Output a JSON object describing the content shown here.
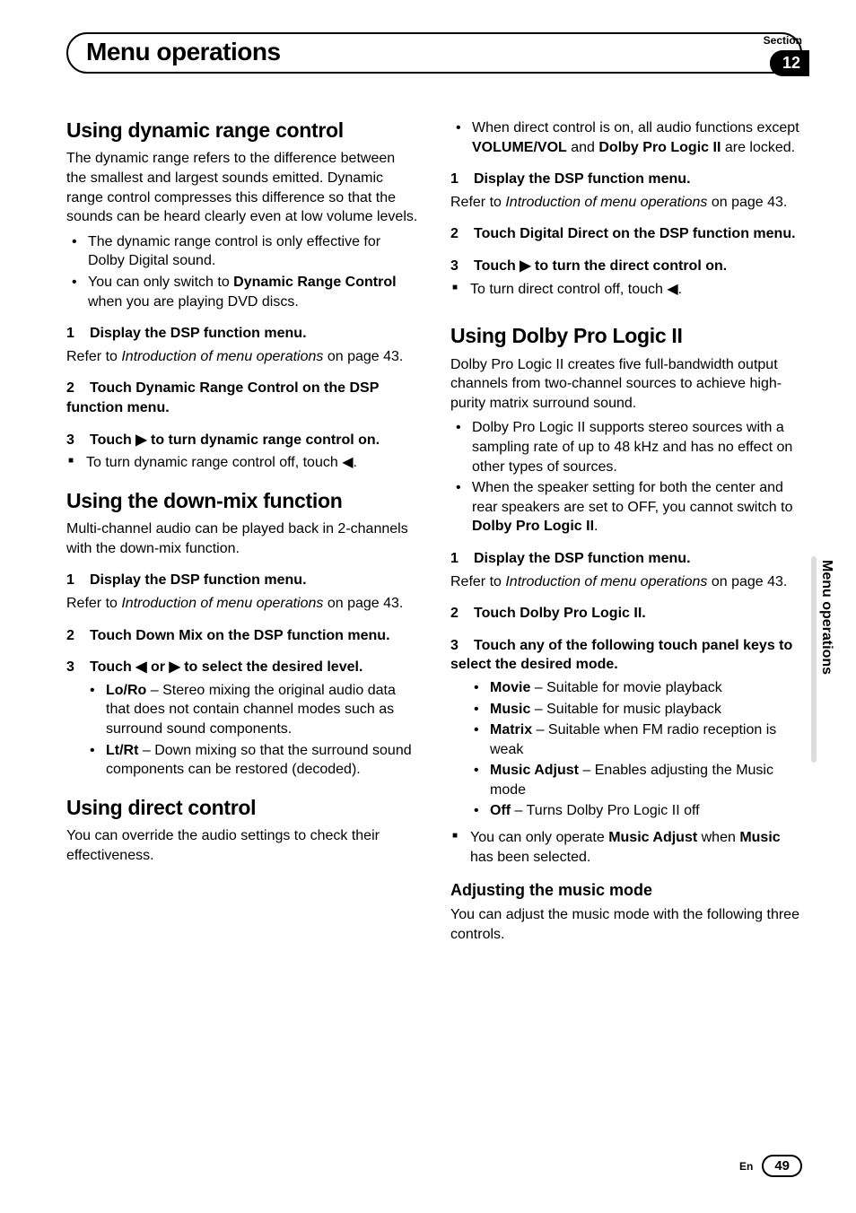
{
  "header": {
    "section_label": "Section",
    "section_number": "12",
    "title": "Menu operations"
  },
  "left": {
    "s1": {
      "h": "Using dynamic range control",
      "p1": "The dynamic range refers to the difference between the smallest and largest sounds emitted. Dynamic range control compresses this difference so that the sounds can be heard clearly even at low volume levels.",
      "b1": "The dynamic range control is only effective for Dolby Digital sound.",
      "b2a": "You can only switch to ",
      "b2b": "Dynamic Range Control",
      "b2c": " when you are playing DVD discs.",
      "step1": "Display the DSP function menu.",
      "step1_ref_a": "Refer to ",
      "step1_ref_b": "Introduction of menu operations",
      "step1_ref_c": " on page 43.",
      "step2": "Touch Dynamic Range Control on the DSP function menu.",
      "step3": "Touch ▶ to turn dynamic range control on.",
      "note1": "To turn dynamic range control off, touch ◀."
    },
    "s2": {
      "h": "Using the down-mix function",
      "p1": "Multi-channel audio can be played back in 2-channels with the down-mix function.",
      "step1": "Display the DSP function menu.",
      "step1_ref_a": "Refer to ",
      "step1_ref_b": "Introduction of menu operations",
      "step1_ref_c": " on page 43.",
      "step2": "Touch Down Mix on the DSP function menu.",
      "step3": "Touch ◀ or ▶ to select the desired level.",
      "sub1a": "Lo/Ro",
      "sub1b": " – Stereo mixing the original audio data that does not contain channel modes such as surround sound components.",
      "sub2a": "Lt/Rt",
      "sub2b": " – Down mixing so that the surround sound components can be restored (decoded)."
    },
    "s3": {
      "h": "Using direct control",
      "p1": "You can override the audio settings to check their effectiveness."
    }
  },
  "right": {
    "cont": {
      "b1a": "When direct control is on, all audio functions except ",
      "b1b": "VOLUME/VOL",
      "b1c": " and ",
      "b1d": "Dolby Pro Logic II",
      "b1e": " are locked.",
      "step1": "Display the DSP function menu.",
      "step1_ref_a": "Refer to ",
      "step1_ref_b": "Introduction of menu operations",
      "step1_ref_c": " on page 43.",
      "step2": "Touch Digital Direct on the DSP function menu.",
      "step3": "Touch ▶ to turn the direct control on.",
      "note1": "To turn direct control off, touch ◀."
    },
    "s4": {
      "h": "Using Dolby Pro Logic II",
      "p1": "Dolby Pro Logic II creates five full-bandwidth output channels from two-channel sources to achieve high-purity matrix surround sound.",
      "b1": "Dolby Pro Logic II supports stereo sources with a sampling rate of up to 48 kHz and has no effect on other types of sources.",
      "b2a": "When the speaker setting for both the center and rear speakers are set to OFF, you cannot switch to ",
      "b2b": "Dolby Pro Logic II",
      "b2c": ".",
      "step1": "Display the DSP function menu.",
      "step1_ref_a": "Refer to ",
      "step1_ref_b": "Introduction of menu operations",
      "step1_ref_c": " on page 43.",
      "step2": "Touch Dolby Pro Logic II.",
      "step3": "Touch any of the following touch panel keys to select the desired mode.",
      "m1a": "Movie",
      "m1b": " – Suitable for movie playback",
      "m2a": "Music",
      "m2b": " – Suitable for music playback",
      "m3a": "Matrix",
      "m3b": " – Suitable when FM radio reception is weak",
      "m4a": "Music Adjust",
      "m4b": " – Enables adjusting the Music mode",
      "m5a": "Off",
      "m5b": " – Turns Dolby Pro Logic II off",
      "note_a": "You can only operate ",
      "note_b": "Music Adjust",
      "note_c": " when ",
      "note_d": "Music",
      "note_e": " has been selected.",
      "h3": "Adjusting the music mode",
      "p2": "You can adjust the music mode with the following three controls."
    }
  },
  "side_tab": "Menu operations",
  "footer": {
    "lang": "En",
    "page": "49"
  }
}
